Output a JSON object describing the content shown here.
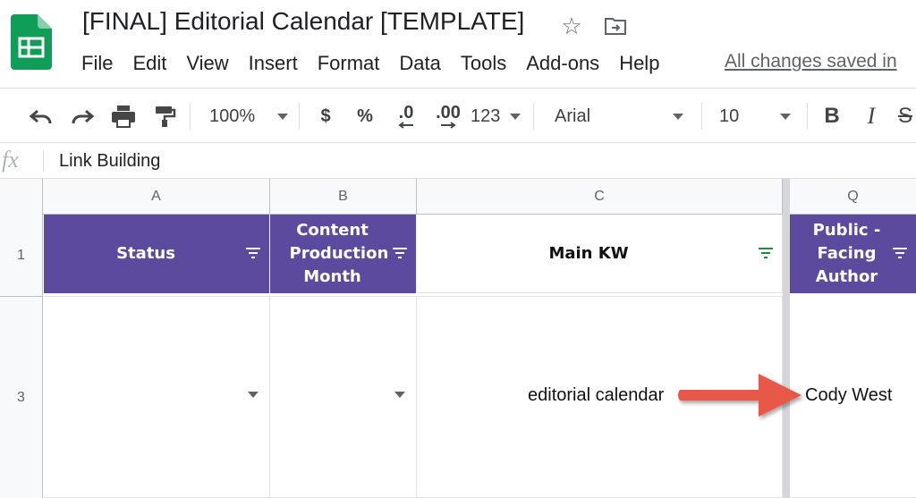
{
  "document": {
    "title": "[FINAL] Editorial Calendar [TEMPLATE]",
    "saved_status": "All changes saved in",
    "logo_icon": "google-sheets-logo",
    "star_icon": "star-icon",
    "move_icon": "move-to-folder-icon"
  },
  "menu": [
    "File",
    "Edit",
    "View",
    "Insert",
    "Format",
    "Data",
    "Tools",
    "Add-ons",
    "Help"
  ],
  "toolbar": {
    "zoom": "100%",
    "currency": "$",
    "percent": "%",
    "decrease_decimal": ".0",
    "increase_decimal": ".00",
    "more_formats": "123",
    "font": "Arial",
    "font_size": "10",
    "bold": "B",
    "italic": "I",
    "strike": "S"
  },
  "formula_bar": {
    "fx": "fx",
    "value": "Link Building"
  },
  "grid": {
    "columns": [
      "A",
      "B",
      "C",
      "Q"
    ],
    "rows": [
      "1",
      "3"
    ],
    "headers": {
      "status": "Status",
      "content_month": "Content Production Month",
      "main_kw": "Main KW",
      "author": "Public - Facing Author"
    },
    "row3": {
      "main_kw": "editorial calendar",
      "author": "Cody West"
    }
  },
  "colors": {
    "header_purple": "#5b4a9e",
    "annotation_arrow": "#e8584a",
    "sheets_green": "#0f9d58"
  }
}
